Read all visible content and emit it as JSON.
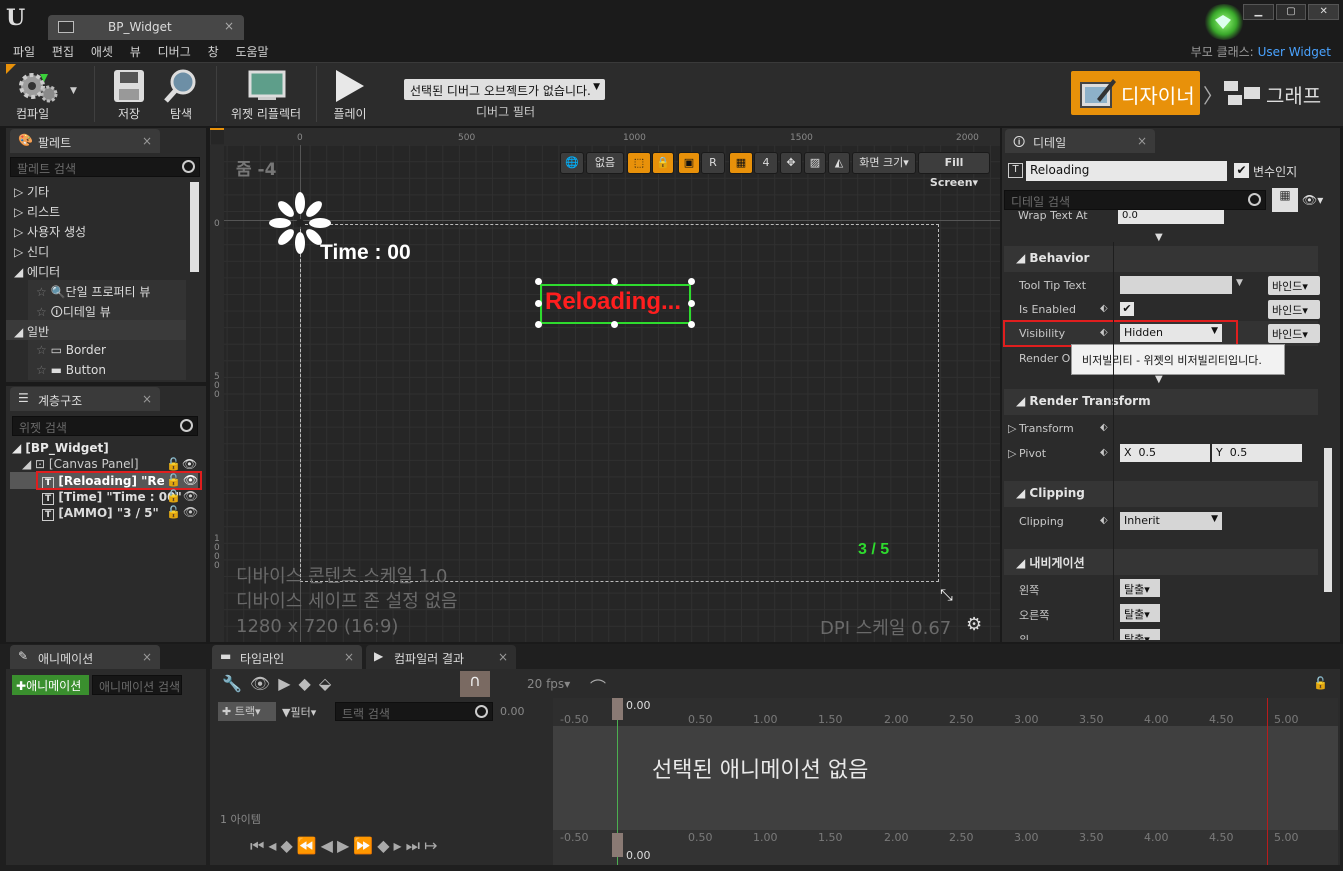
{
  "window": {
    "tab_title": "BP_Widget",
    "parent_class_label": "부모 클래스:",
    "parent_class_value": "User Widget"
  },
  "menu": [
    "파일",
    "편집",
    "애셋",
    "뷰",
    "디버그",
    "창",
    "도움말"
  ],
  "toolbar": {
    "compile": "컴파일",
    "save": "저장",
    "browse": "탐색",
    "reflector": "위젯 리플렉터",
    "play": "플레이",
    "debug_select": "선택된 디버그 오브젝트가 없습니다.",
    "debug_filter": "디버그 필터",
    "designer": "디자이너",
    "graph": "그래프"
  },
  "palette": {
    "title": "팔레트",
    "search_placeholder": "팔레트 검색",
    "categories": [
      "기타",
      "리스트",
      "사용자 생성",
      "신디",
      "에디터"
    ],
    "editor_items": [
      "단일 프로퍼티 뷰",
      "디테일 뷰"
    ],
    "general_label": "일반",
    "general_items": [
      "Border",
      "Button"
    ]
  },
  "hierarchy": {
    "title": "계층구조",
    "search_placeholder": "위젯 검색",
    "root": "[BP_Widget]",
    "canvas": "[Canvas Panel]",
    "items": [
      "[Reloading] \"Reloa",
      "[Time] \"Time : 00\"",
      "[AMMO] \"3 / 5\""
    ]
  },
  "viewport": {
    "zoom": "줌 -4",
    "ruler_h": [
      "0",
      "500",
      "1000",
      "1500",
      "2000"
    ],
    "ruler_v": [
      "0",
      "5 0 0",
      "1 0 0 0"
    ],
    "tool_none": "없음",
    "tool_r": "R",
    "tool_grid": "4",
    "screen_size": "화면 크기",
    "fill_screen": "Fill Screen",
    "time_text": "Time : 00",
    "reloading_text": "Reloading...",
    "ammo_text": "3 / 5",
    "info_lines": [
      "디바이스 콘텐츠 스케일 1.0",
      "디바이스 세이프 존 설정 없음",
      "1280 x 720 (16:9)"
    ],
    "dpi": "DPI 스케일 0.67"
  },
  "details": {
    "title": "디테일",
    "name_value": "Reloading",
    "is_variable": "변수인지",
    "search_placeholder": "디테일 검색",
    "wrap_text": "Wrap Text At",
    "wrap_value": "0.0",
    "behavior": "Behavior",
    "tooltip": "Tool Tip Text",
    "is_enabled": "Is Enabled",
    "visibility": "Visibility",
    "visibility_value": "Hidden",
    "render_op": "Render Op",
    "tooltip_popup": "비저빌리티 - 위젯의 비저빌리티입니다.",
    "bind": "바인드",
    "render_transform": "Render Transform",
    "transform": "Transform",
    "pivot": "Pivot",
    "pivot_x": "0.5",
    "pivot_y": "0.5",
    "clipping": "Clipping",
    "clipping_value": "Inherit",
    "navigation": "내비게이션",
    "nav_left": "왼쪽",
    "nav_right": "오른쪽",
    "nav_up": "위",
    "nav_value": "탈출"
  },
  "bottom": {
    "anim_tab": "애니메이션",
    "add_anim": "애니메이션",
    "anim_search": "애니메이션 검색",
    "timeline_tab": "타임라인",
    "compiler_tab": "컴파일러 결과",
    "fps": "20 fps",
    "track": "트랙",
    "filter": "필터",
    "track_search": "트랙 검색",
    "time": "0.00",
    "items_count": "1 아이템",
    "no_anim": "선택된 애니메이션 없음",
    "ticks": [
      "-0.50",
      "0.50",
      "1.00",
      "1.50",
      "2.00",
      "2.50",
      "3.00",
      "3.50",
      "4.00",
      "4.50",
      "5.00"
    ]
  }
}
